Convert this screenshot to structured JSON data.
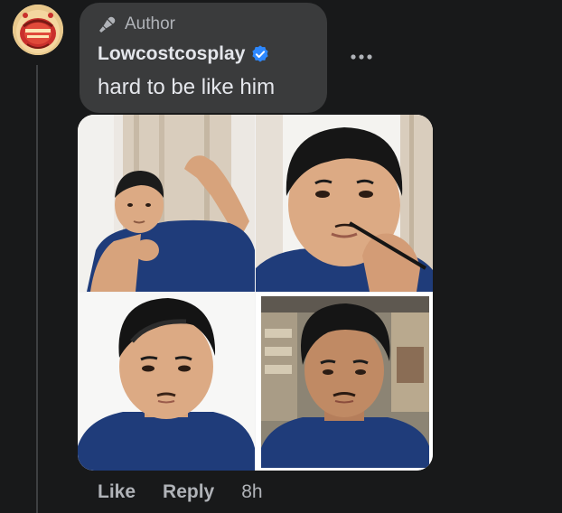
{
  "comment": {
    "author_badge": "Author",
    "author_name": "Lowcostcosplay",
    "text": "hard to be like him",
    "verified": true,
    "accent_color": "#2d88ff"
  },
  "avatar": {
    "logo_text": "Lowcostcosplay"
  },
  "media": {
    "photo_count": 4
  },
  "actions": {
    "like_label": "Like",
    "reply_label": "Reply",
    "timestamp": "8h"
  },
  "icons": {
    "badge": "microphone-icon",
    "verified": "verified-check-icon",
    "more": "more-options-icon"
  },
  "colors": {
    "background": "#18191a",
    "bubble": "#3a3b3c",
    "primary_text": "#e4e6eb",
    "secondary_text": "#b0b3b8"
  }
}
